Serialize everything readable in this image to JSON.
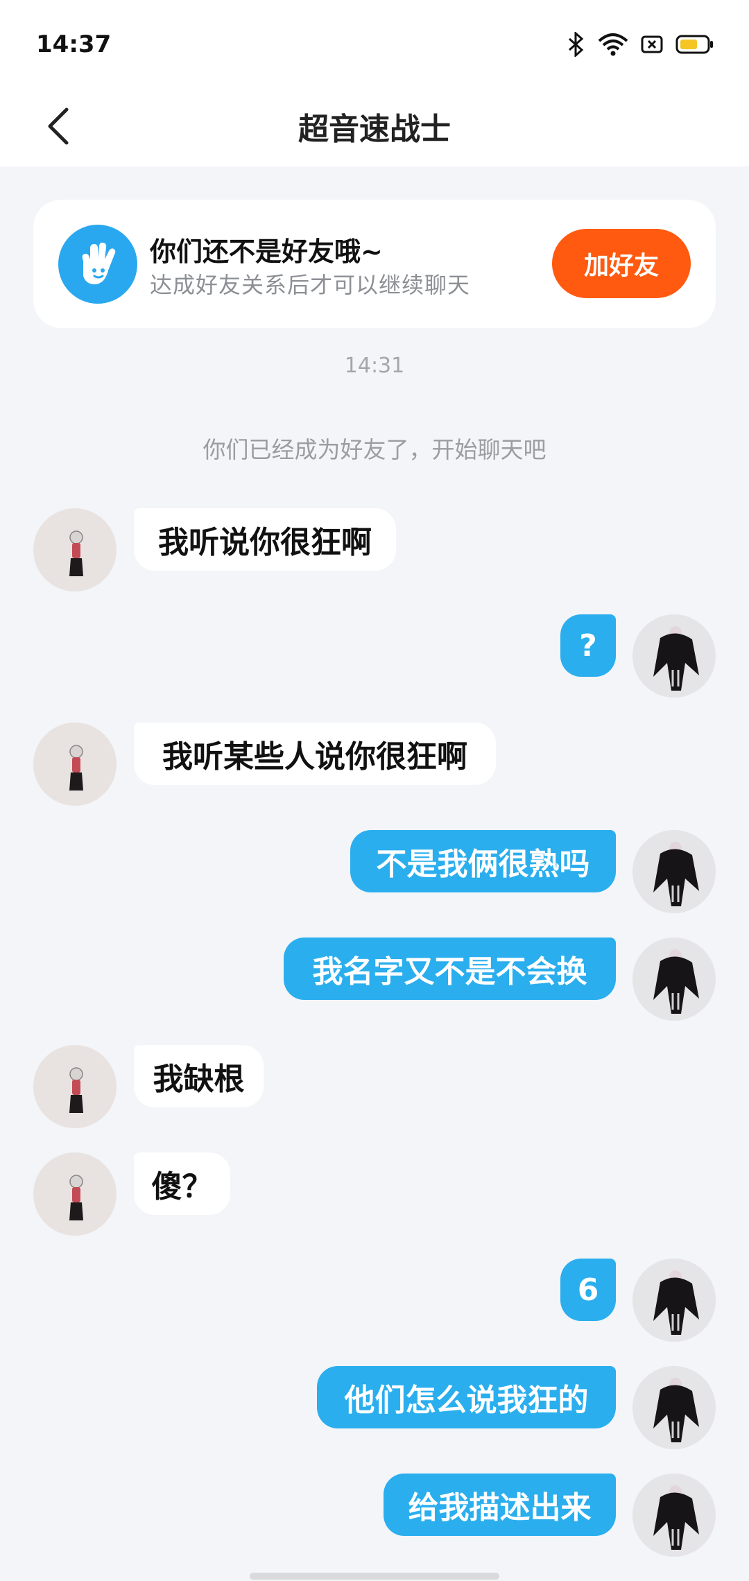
{
  "status_bar": {
    "time": "14:37",
    "icons": [
      "bluetooth-icon",
      "wifi-icon",
      "sim-icon",
      "battery-icon"
    ]
  },
  "header": {
    "title": "超音速战士"
  },
  "friend_card": {
    "title": "你们还不是好友哦~",
    "subtitle": "达成好友关系后才可以继续聊天",
    "button": "加好友"
  },
  "timestamp": "14:31",
  "system_message": "你们已经成为好友了，开始聊天吧",
  "messages": [
    {
      "side": "in",
      "text": "我听说你很狂啊"
    },
    {
      "side": "out",
      "text": "?"
    },
    {
      "side": "in",
      "text": "我听某些人说你很狂啊"
    },
    {
      "side": "out",
      "text": "不是我俩很熟吗"
    },
    {
      "side": "out",
      "text": "我名字又不是不会换"
    },
    {
      "side": "in",
      "text": "我缺根"
    },
    {
      "side": "in",
      "text": "傻？"
    },
    {
      "side": "out",
      "text": "6"
    },
    {
      "side": "out",
      "text": "他们怎么说我狂的"
    },
    {
      "side": "out",
      "text": "给我描述出来"
    }
  ],
  "colors": {
    "accent": "#2aaeee",
    "add_button": "#ff5a0f",
    "background": "#f3f5f8"
  }
}
